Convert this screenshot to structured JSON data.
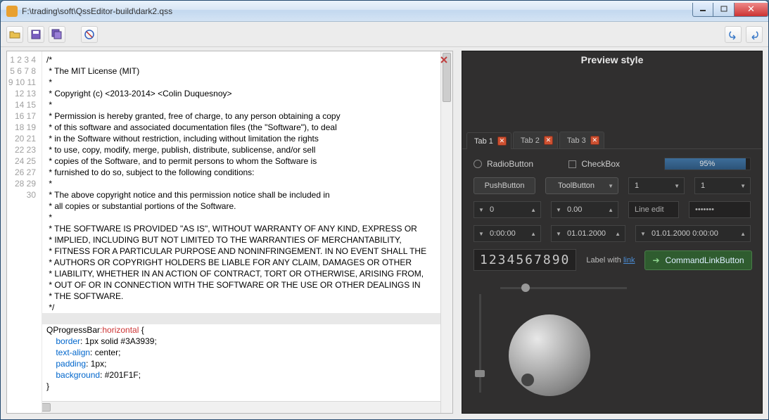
{
  "window": {
    "title": "F:\\trading\\soft\\QssEditor-build\\dark2.qss"
  },
  "toolbar": {
    "open": "Open",
    "save": "Save",
    "saveall": "Save All",
    "stop": "Stop",
    "undo": "Undo",
    "redo": "Redo"
  },
  "editor": {
    "lines": [
      "/*",
      " * The MIT License (MIT)",
      " *",
      " * Copyright (c) <2013-2014> <Colin Duquesnoy>",
      " *",
      " * Permission is hereby granted, free of charge, to any person obtaining a copy",
      " * of this software and associated documentation files (the \"Software\"), to deal",
      " * in the Software without restriction, including without limitation the rights",
      " * to use, copy, modify, merge, publish, distribute, sublicense, and/or sell",
      " * copies of the Software, and to permit persons to whom the Software is",
      " * furnished to do so, subject to the following conditions:",
      " *",
      " * The above copyright notice and this permission notice shall be included in",
      " * all copies or substantial portions of the Software.",
      " *",
      " * THE SOFTWARE IS PROVIDED \"AS IS\", WITHOUT WARRANTY OF ANY KIND, EXPRESS OR",
      " * IMPLIED, INCLUDING BUT NOT LIMITED TO THE WARRANTIES OF MERCHANTABILITY,",
      " * FITNESS FOR A PARTICULAR PURPOSE AND NONINFRINGEMENT. IN NO EVENT SHALL THE",
      " * AUTHORS OR COPYRIGHT HOLDERS BE LIABLE FOR ANY CLAIM, DAMAGES OR OTHER",
      " * LIABILITY, WHETHER IN AN ACTION OF CONTRACT, TORT OR OTHERWISE, ARISING FROM,",
      " * OUT OF OR IN CONNECTION WITH THE SOFTWARE OR THE USE OR OTHER DEALINGS IN",
      " * THE SOFTWARE.",
      " */",
      "",
      "QProgressBar:horizontal {",
      "    border: 1px solid #3A3939;",
      "    text-align: center;",
      "    padding: 1px;",
      "    background: #201F1F;",
      "}"
    ],
    "css_lines": {
      "25": {
        "sel": "QProgressBar",
        "pseudo": ":horizontal",
        "rest": " {"
      },
      "26": {
        "prop": "border",
        "val": " 1px solid #3A3939;"
      },
      "27": {
        "prop": "text-align",
        "val": " center;"
      },
      "28": {
        "prop": "padding",
        "val": " 1px;"
      },
      "29": {
        "prop": "background",
        "val": " #201F1F;"
      },
      "30": {
        "plain": "}"
      }
    }
  },
  "preview": {
    "title": "Preview style",
    "tabs": [
      "Tab 1",
      "Tab 2",
      "Tab 3"
    ],
    "radio": "RadioButton",
    "checkbox": "CheckBox",
    "progress": "95%",
    "pushbutton": "PushButton",
    "toolbutton": "ToolButton",
    "combo1": "1",
    "combo2": "1",
    "spin1": "0",
    "spin2": "0.00",
    "lineedit_ph": "Line edit",
    "password": "•••••••",
    "time": "0:00:00",
    "date": "01.01.2000",
    "datetime": "01.01.2000 0:00:00",
    "lcd": "1234567890",
    "label_text": "Label with ",
    "label_link": "link",
    "cmdlink": "CommandLinkButton"
  }
}
